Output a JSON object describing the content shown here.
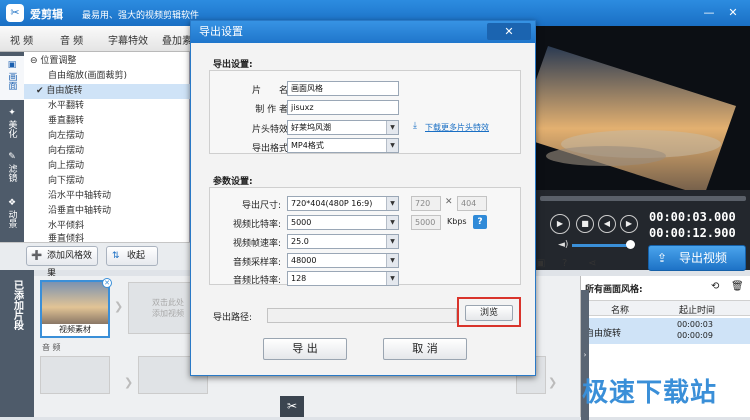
{
  "app": {
    "name": "爱剪辑",
    "slogan": "最易用、强大的视频剪辑软件",
    "min_icon": "minimize-icon",
    "close_icon": "close-icon"
  },
  "menu": [
    "视 频",
    "音 频",
    "字幕特效",
    "叠加素"
  ],
  "sidebar": [
    "画面",
    "美化",
    "滤镜",
    "动景"
  ],
  "effects": {
    "group": "位置调整",
    "items": [
      "自由缩放(画面裁剪)",
      "自由旋转",
      "水平翻转",
      "垂直翻转",
      "向左摆动",
      "向右摆动",
      "向上摆动",
      "向下摆动",
      "沿水平中轴转动",
      "沿垂直中轴转动",
      "水平倾斜",
      "垂直倾斜"
    ],
    "selected": 1
  },
  "buttons": {
    "add_effect": "添加风格效果",
    "collapse": "收起"
  },
  "timeline": {
    "strip_label": "已添加片段",
    "clip_label": "视频素材",
    "empty_hint": "双击此处\n添加视频",
    "audio": "音 频"
  },
  "player": {
    "time_current": "00:00:03.000",
    "time_total": "00:00:12.900",
    "export": "导出视频"
  },
  "list": {
    "title": "所有画面风格:",
    "col_name": "名称",
    "col_time": "起止时间",
    "row_name": "自由旋转",
    "row_start": "00:00:03",
    "row_end": "00:00:09"
  },
  "dialog": {
    "title": "导出设置",
    "export_section": "导出设置:",
    "name_label": "片　　名:",
    "name_value": "画面风格",
    "author_label": "制 作 者:",
    "author_value": "jisuxz",
    "intro_label": "片头特效:",
    "intro_value": "好莱坞风潮",
    "download_link": "下载更多片头特效",
    "format_label": "导出格式:",
    "format_value": "MP4格式",
    "params_section": "参数设置:",
    "size_label": "导出尺寸:",
    "size_value": "720*404(480P 16:9)",
    "width": "720",
    "height": "404",
    "vbitrate_label": "视频比特率:",
    "vbitrate_value": "5000",
    "vbitrate_box": "5000",
    "vbitrate_unit": "Kbps",
    "help": "?",
    "fps_label": "视频帧速率:",
    "fps_value": "25.0",
    "asample_label": "音频采样率:",
    "asample_value": "48000",
    "abitrate_label": "音频比特率:",
    "abitrate_value": "128",
    "path_label": "导出路径:",
    "path_value": "",
    "browse": "浏览",
    "export": "导 出",
    "cancel": "取 消",
    "close": "✕"
  },
  "watermark": "极速下载站",
  "colors": {
    "accent": "#1f76cb",
    "highlight_box": "#d9342b"
  }
}
